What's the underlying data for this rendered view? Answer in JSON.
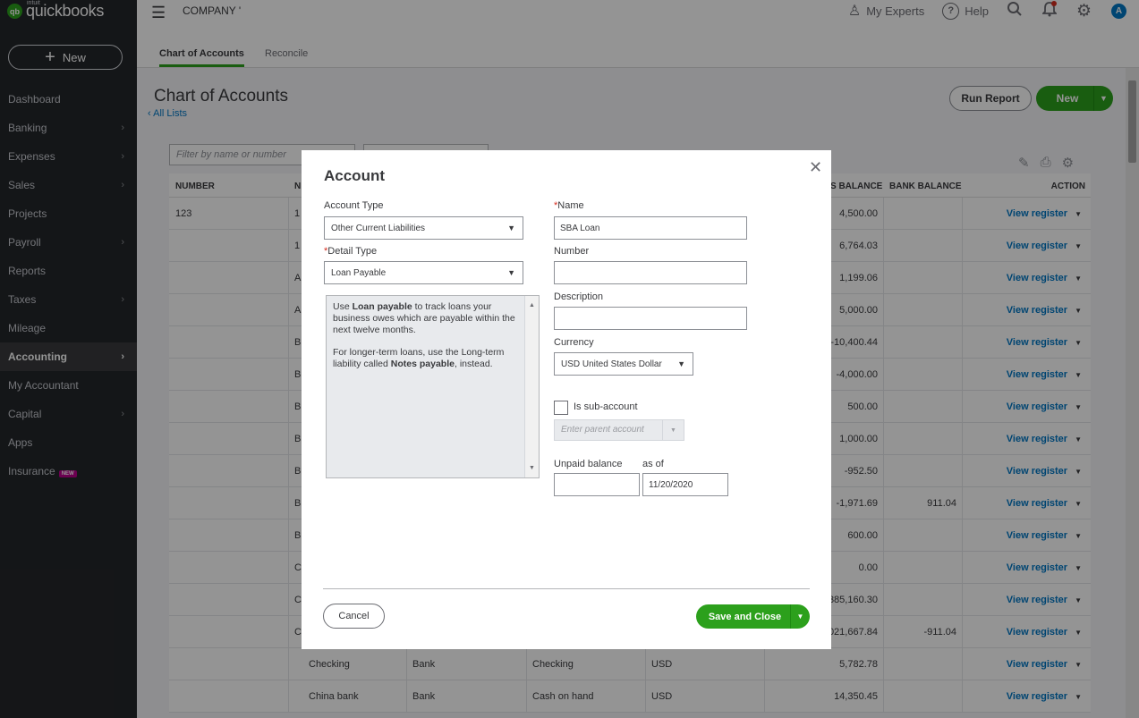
{
  "sidebar": {
    "logo_intuit": "intuit",
    "logo_text": "quickbooks",
    "logo_mark": "qb",
    "new_label": "New",
    "items": [
      {
        "label": "Dashboard",
        "chevron": false
      },
      {
        "label": "Banking",
        "chevron": true
      },
      {
        "label": "Expenses",
        "chevron": true
      },
      {
        "label": "Sales",
        "chevron": true
      },
      {
        "label": "Projects",
        "chevron": false
      },
      {
        "label": "Payroll",
        "chevron": true
      },
      {
        "label": "Reports",
        "chevron": false
      },
      {
        "label": "Taxes",
        "chevron": true
      },
      {
        "label": "Mileage",
        "chevron": false
      },
      {
        "label": "Accounting",
        "chevron": true,
        "active": true
      },
      {
        "label": "My Accountant",
        "chevron": false
      },
      {
        "label": "Capital",
        "chevron": true
      },
      {
        "label": "Apps",
        "chevron": false
      },
      {
        "label": "Insurance",
        "chevron": false,
        "badge": "NEW"
      }
    ]
  },
  "topbar": {
    "company": "COMPANY '",
    "my_experts": "My Experts",
    "help": "Help",
    "avatar_letter": "A"
  },
  "tabs": [
    "Chart of Accounts",
    "Reconcile"
  ],
  "main": {
    "title": "Chart of Accounts",
    "all_lists": "All Lists",
    "run_report": "Run Report",
    "new_label": "New",
    "filter_placeholder": "Filter by name or number"
  },
  "table": {
    "headers": {
      "number": "NUMBER",
      "name": "N",
      "balance": "S BALANCE",
      "bank_balance": "BANK BALANCE",
      "action": "ACTION"
    },
    "rows": [
      {
        "number": "123",
        "name": "1",
        "type": "",
        "detail": "",
        "currency": "",
        "balance": "4,500.00",
        "bank": "",
        "action": "View register"
      },
      {
        "number": "",
        "name": "1",
        "type": "",
        "detail": "",
        "currency": "",
        "balance": "6,764.03",
        "bank": "",
        "action": "View register"
      },
      {
        "number": "",
        "name": "A",
        "type": "",
        "detail": "",
        "currency": "",
        "balance": "1,199.06",
        "bank": "",
        "action": "View register"
      },
      {
        "number": "",
        "name": "A",
        "type": "",
        "detail": "",
        "currency": "",
        "balance": "5,000.00",
        "bank": "",
        "action": "View register"
      },
      {
        "number": "",
        "name": "B",
        "type": "",
        "detail": "",
        "currency": "",
        "balance": "-10,400.44",
        "bank": "",
        "action": "View register"
      },
      {
        "number": "",
        "name": "B",
        "type": "",
        "detail": "",
        "currency": "",
        "balance": "-4,000.00",
        "bank": "",
        "action": "View register"
      },
      {
        "number": "",
        "name": "B",
        "type": "",
        "detail": "",
        "currency": "",
        "balance": "500.00",
        "bank": "",
        "action": "View register"
      },
      {
        "number": "",
        "name": "B",
        "type": "",
        "detail": "",
        "currency": "",
        "balance": "1,000.00",
        "bank": "",
        "action": "View register"
      },
      {
        "number": "",
        "name": "B",
        "type": "",
        "detail": "",
        "currency": "",
        "balance": "-952.50",
        "bank": "",
        "action": "View register"
      },
      {
        "number": "",
        "name": "B",
        "type": "",
        "detail": "",
        "currency": "",
        "balance": "-1,971.69",
        "bank": "911.04",
        "action": "View register"
      },
      {
        "number": "",
        "name": "B",
        "type": "",
        "detail": "",
        "currency": "",
        "balance": "600.00",
        "bank": "",
        "action": "View register"
      },
      {
        "number": "",
        "name": "C",
        "type": "",
        "detail": "",
        "currency": "",
        "balance": "0.00",
        "bank": "",
        "action": "View register"
      },
      {
        "number": "",
        "name": "C",
        "type": "",
        "detail": "",
        "currency": "",
        "balance": "385,160.30",
        "bank": "",
        "action": "View register"
      },
      {
        "number": "",
        "name": "C",
        "type": "",
        "detail": "",
        "currency": "",
        "balance": "021,667.84",
        "bank": "-911.04",
        "action": "View register"
      },
      {
        "number": "",
        "name": "Checking",
        "type": "Bank",
        "detail": "Checking",
        "currency": "USD",
        "balance": "5,782.78",
        "bank": "",
        "action": "View register"
      },
      {
        "number": "",
        "name": "China bank",
        "type": "Bank",
        "detail": "Cash on hand",
        "currency": "USD",
        "balance": "14,350.45",
        "bank": "",
        "action": "View register"
      }
    ]
  },
  "modal": {
    "title": "Account",
    "account_type_label": "Account Type",
    "account_type_value": "Other Current Liabilities",
    "detail_type_label": "Detail Type",
    "detail_type_value": "Loan Payable",
    "help_p1_a": "Use ",
    "help_p1_b": "Loan payable",
    "help_p1_c": " to track loans your business owes which are payable within the next twelve months.",
    "help_p2_a": "For longer-term loans, use the Long-term liability called ",
    "help_p2_b": "Notes payable",
    "help_p2_c": ", instead.",
    "name_label": "Name",
    "name_value": "SBA Loan",
    "number_label": "Number",
    "number_value": "",
    "description_label": "Description",
    "description_value": "",
    "currency_label": "Currency",
    "currency_value": "USD United States Dollar",
    "sub_account_label": "Is sub-account",
    "sub_account_checked": false,
    "parent_placeholder": "Enter parent account",
    "unpaid_label": "Unpaid balance",
    "unpaid_value": "",
    "as_of_label": "as of",
    "as_of_value": "11/20/2020",
    "cancel_label": "Cancel",
    "save_label": "Save and Close"
  },
  "colors": {
    "brand_green": "#2ca01c",
    "link_blue": "#0077c5",
    "sidebar_bg": "#24262a"
  }
}
